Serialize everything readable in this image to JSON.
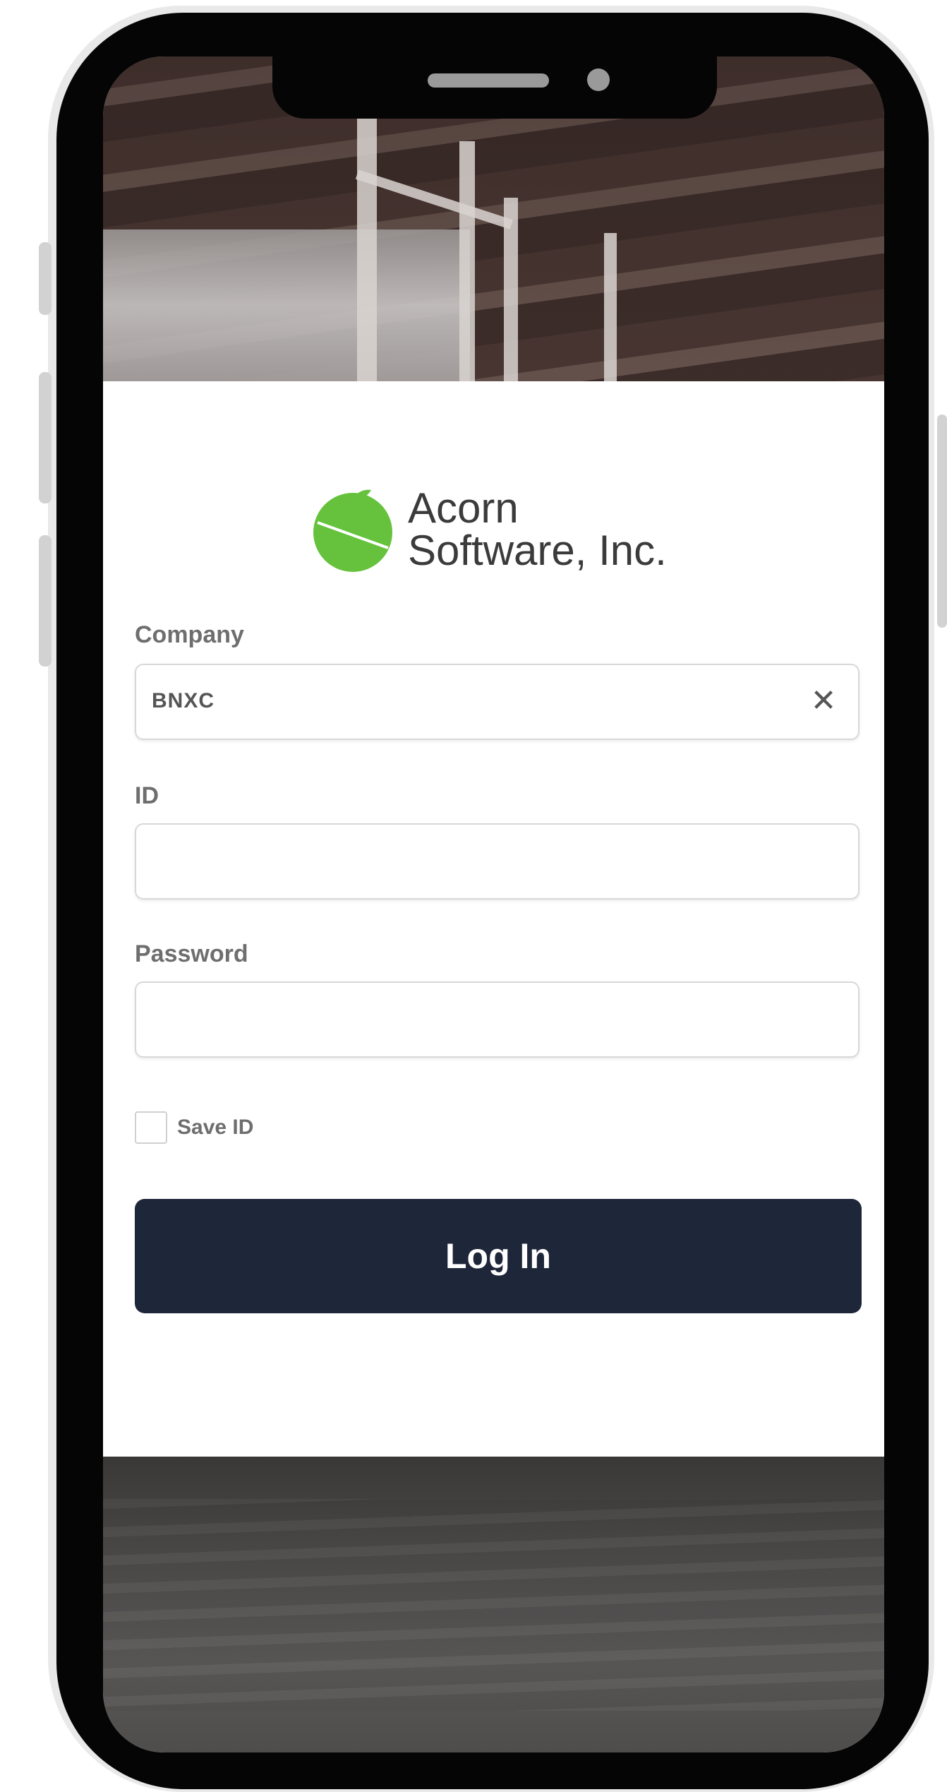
{
  "brand": {
    "line1": "Acorn",
    "line2": "Software, Inc.",
    "logo_color": "#66c23d"
  },
  "form": {
    "company_label": "Company",
    "company_value": "BNXC",
    "clear_icon": "close-icon",
    "id_label": "ID",
    "id_value": "",
    "password_label": "Password",
    "password_value": "",
    "save_id_label": "Save ID",
    "save_id_checked": false
  },
  "actions": {
    "login_label": "Log In",
    "login_color": "#1e2639"
  }
}
